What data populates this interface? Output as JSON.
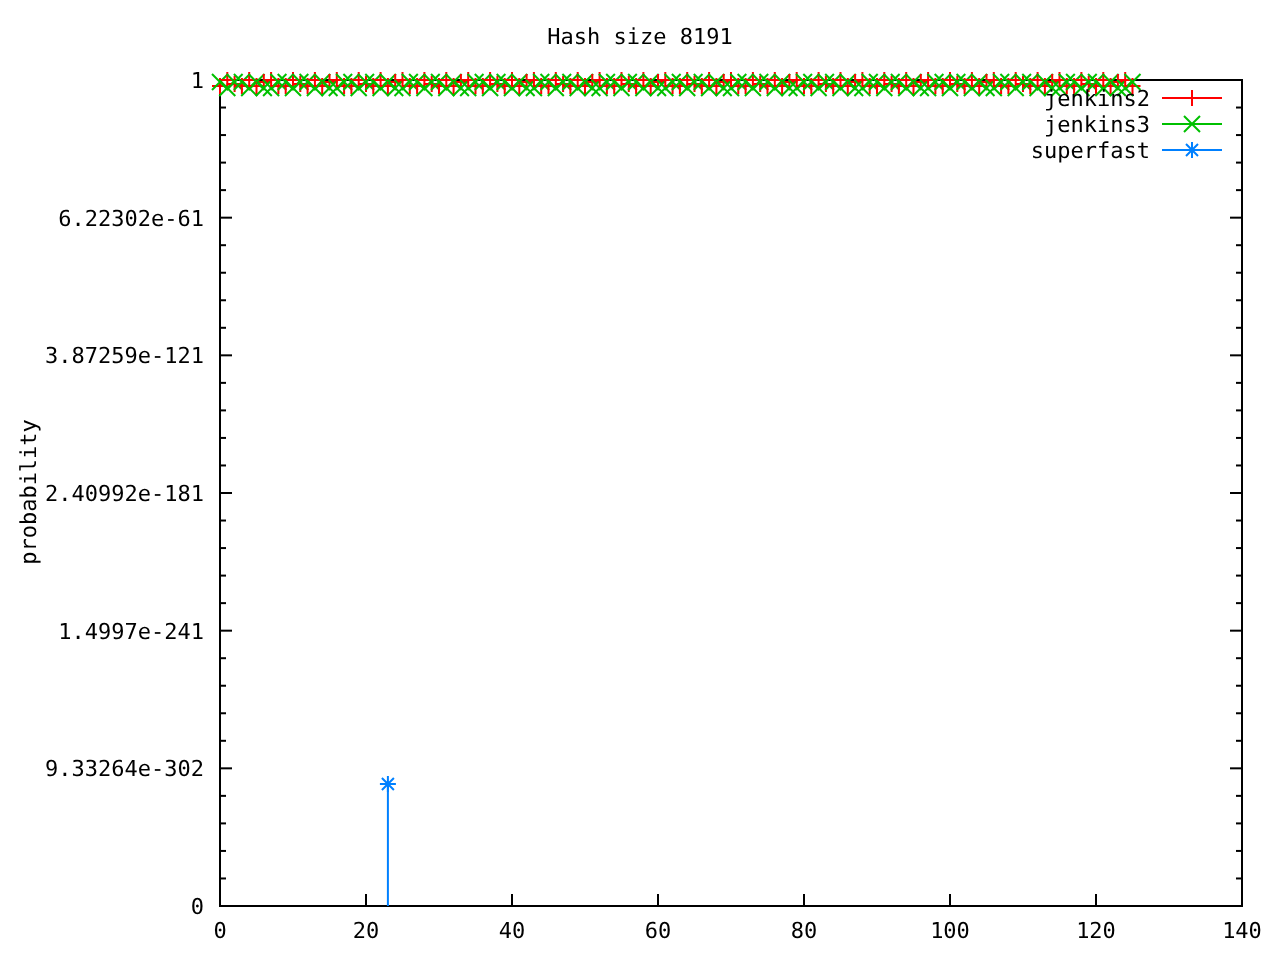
{
  "plot": {
    "title": "Hash size 8191",
    "ylabel": "probability",
    "y_axis_labels": [
      "1",
      "6.22302e-61",
      "3.87259e-121",
      "2.40992e-181",
      "1.4997e-241",
      "9.33264e-302",
      "0"
    ],
    "x_axis_labels": [
      "0",
      "20",
      "40",
      "60",
      "80",
      "100",
      "120",
      "140"
    ],
    "legend": [
      {
        "name": "jenkins2",
        "color": "#ff0000"
      },
      {
        "name": "jenkins3",
        "color": "#00c000"
      },
      {
        "name": "superfast",
        "color": "#0080ff"
      }
    ]
  }
}
